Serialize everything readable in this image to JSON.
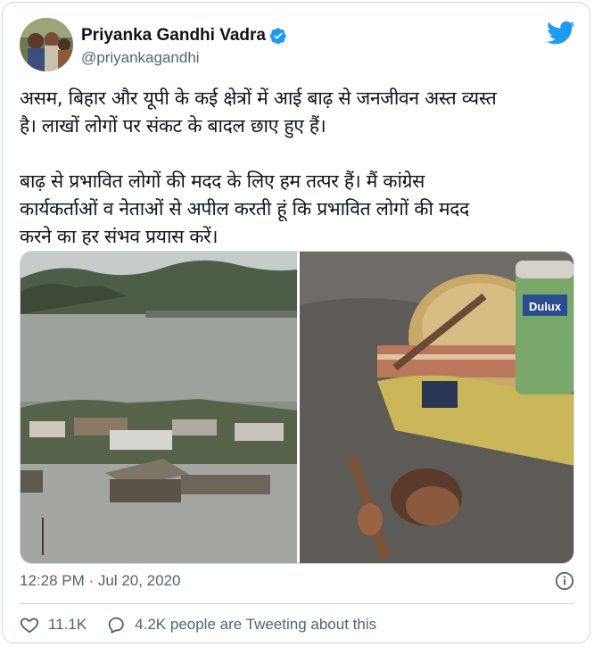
{
  "author": {
    "name": "Priyanka Gandhi Vadra",
    "handle": "@priyankagandhi"
  },
  "tweet": {
    "text": "असम, बिहार और यूपी के कई क्षेत्रों में आई बाढ़ से जनजीवन अस्त व्यस्त\nहै। लाखों लोगों पर संकट के बादल छाए हुए हैं।\n\nबाढ़ से प्रभावित लोगों की मदद के लिए हम तत्पर हैं। मैं कांग्रेस\nकार्यकर्ताओं व नेताओं से अपील करती हूं कि प्रभावित लोगों की मदद\nकरने का हर संभव प्रयास करें।",
    "timestamp": "12:28 PM · Jul 20, 2020",
    "likes": "11.1K",
    "conversation": "4.2K people are Tweeting about this"
  },
  "media": {
    "right_image_brand_text": "Dulux"
  },
  "icons": {
    "verified": "verified-badge-icon",
    "logo": "twitter-bird-icon",
    "info": "info-icon",
    "like": "heart-icon",
    "reply": "speech-bubble-icon"
  },
  "colors": {
    "accent": "#1d9bf0",
    "text": "#0f1419",
    "muted": "#536471",
    "border": "#cfd9de"
  }
}
